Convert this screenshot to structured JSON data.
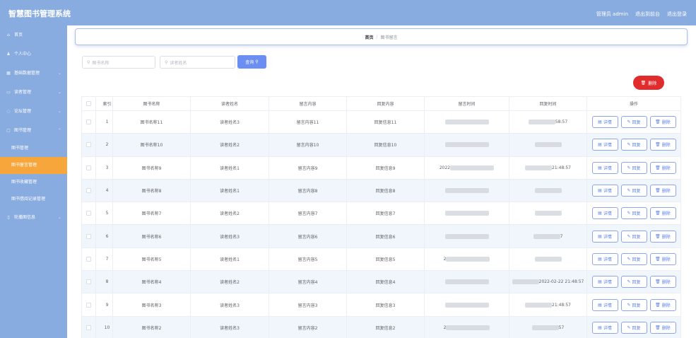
{
  "header": {
    "title": "智慧图书管理系统",
    "admin_label": "管理员 admin",
    "back_label": "退出到前台",
    "logout_label": "退出登录"
  },
  "sidebar": {
    "items": [
      {
        "label": "首页",
        "icon": "home-icon"
      },
      {
        "label": "个人中心",
        "icon": "user-icon"
      },
      {
        "label": "基础数据管理",
        "icon": "data-icon"
      },
      {
        "label": "读者管理",
        "icon": "reader-icon"
      },
      {
        "label": "论坛管理",
        "icon": "forum-icon"
      },
      {
        "label": "图书管理",
        "icon": "book-icon"
      }
    ],
    "subitems": [
      "图书管理",
      "图书留言管理",
      "图书收藏管理",
      "图书借阅记录管理"
    ],
    "last_item": {
      "label": "轮播图信息",
      "icon": "image-icon"
    }
  },
  "breadcrumb": {
    "home": "首页",
    "separator": "/",
    "current": "图书留言"
  },
  "search": {
    "book_placeholder": "图书名称",
    "reader_placeholder": "读者姓名",
    "button_label": "查询"
  },
  "actions": {
    "delete_label": "删除"
  },
  "table": {
    "columns": [
      "索引",
      "图书名称",
      "读者姓名",
      "留言内容",
      "回复内容",
      "留言时间",
      "回复时间",
      "操作"
    ],
    "row_ops": {
      "detail": "详情",
      "reply": "回复",
      "delete": "删除"
    },
    "rows": [
      {
        "index": "1",
        "book": "图书名称11",
        "reader": "读者姓名3",
        "message": "留言内容11",
        "reply": "回复信息11",
        "msg_time": "",
        "reply_time": "58:57"
      },
      {
        "index": "2",
        "book": "图书名称10",
        "reader": "读者姓名2",
        "message": "留言内容10",
        "reply": "回复信息10",
        "msg_time": "",
        "reply_time": ""
      },
      {
        "index": "3",
        "book": "图书名称9",
        "reader": "读者姓名1",
        "message": "留言内容9",
        "reply": "回复信息9",
        "msg_time": "2022",
        "reply_time": "21:48:57"
      },
      {
        "index": "4",
        "book": "图书名称8",
        "reader": "读者姓名1",
        "message": "留言内容8",
        "reply": "回复信息8",
        "msg_time": "",
        "reply_time": ""
      },
      {
        "index": "5",
        "book": "图书名称7",
        "reader": "读者姓名2",
        "message": "留言内容7",
        "reply": "回复信息7",
        "msg_time": "",
        "reply_time": ""
      },
      {
        "index": "6",
        "book": "图书名称6",
        "reader": "读者姓名3",
        "message": "留言内容6",
        "reply": "回复信息6",
        "msg_time": "",
        "reply_time": "7"
      },
      {
        "index": "7",
        "book": "图书名称5",
        "reader": "读者姓名1",
        "message": "留言内容5",
        "reply": "回复信息5",
        "msg_time": "2",
        "reply_time": ""
      },
      {
        "index": "8",
        "book": "图书名称4",
        "reader": "读者姓名2",
        "message": "留言内容4",
        "reply": "回复信息4",
        "msg_time": "",
        "reply_time": "2022-02-22 21:48:57"
      },
      {
        "index": "9",
        "book": "图书名称3",
        "reader": "读者姓名3",
        "message": "留言内容3",
        "reply": "回复信息3",
        "msg_time": "",
        "reply_time": "21:48:57"
      },
      {
        "index": "10",
        "book": "图书名称2",
        "reader": "读者姓名3",
        "message": "留言内容2",
        "reply": "回复信息2",
        "msg_time": "2",
        "reply_time": "57"
      }
    ]
  },
  "colors": {
    "sidebar": "#88abe0",
    "active_menu": "#f7a63c",
    "primary": "#6b8ef2",
    "danger": "#e02c2c"
  }
}
